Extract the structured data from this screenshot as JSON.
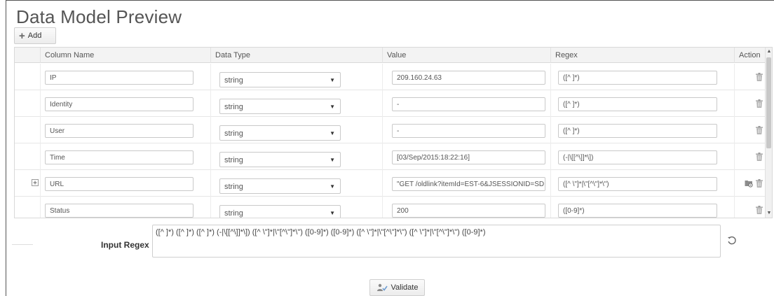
{
  "page": {
    "title": "Data Model Preview"
  },
  "toolbar": {
    "add_label": "Add",
    "add_icon": "plus-icon"
  },
  "table": {
    "columns": [
      "Column Name",
      "Data Type",
      "Value",
      "Regex",
      "Action"
    ],
    "rows": [
      {
        "column_name": "IP",
        "data_type": "string",
        "value": "209.160.24.63",
        "regex": "([^ ]*)",
        "expandable": false,
        "has_secondary_action": false
      },
      {
        "column_name": "Identity",
        "data_type": "string",
        "value": "-",
        "regex": "([^ ]*)",
        "expandable": false,
        "has_secondary_action": false
      },
      {
        "column_name": "User",
        "data_type": "string",
        "value": "-",
        "regex": "([^ ]*)",
        "expandable": false,
        "has_secondary_action": false
      },
      {
        "column_name": "Time",
        "data_type": "string",
        "value": "[03/Sep/2015:18:22:16]",
        "regex": "(-|\\[[^\\]]*\\])",
        "expandable": false,
        "has_secondary_action": false
      },
      {
        "column_name": "URL",
        "data_type": "string",
        "value": "\"GET /oldlink?itemId=EST-6&JSESSIONID=SD",
        "regex": "([^ \\\"]*|\\\"[^\\\"]*\\\")",
        "expandable": true,
        "has_secondary_action": true
      },
      {
        "column_name": "Status",
        "data_type": "string",
        "value": "200",
        "regex": "([0-9]*)",
        "expandable": false,
        "has_secondary_action": false
      }
    ]
  },
  "input_regex": {
    "label": "Input Regex",
    "value": "([^ ]*) ([^ ]*) ([^ ]*) (-|\\[[^\\]]*\\]) ([^ \\\"]*|\\\"[^\\\"]*\\\") ([0-9]*) ([0-9]*) ([^ \\\"]*|\\\"[^\\\"]*\\\") ([^ \\\"]*|\\\"[^\\\"]*\\\") ([0-9]*)"
  },
  "actions": {
    "validate_label": "Validate"
  },
  "icons": {
    "trash": "trash-icon",
    "reset": "reset-icon",
    "expand": "expand-icon",
    "validate": "validate-icon",
    "secondary": "folder-settings-icon"
  },
  "colors": {
    "icon_gray": "#9a9a9a",
    "border": "#cfcfcf"
  }
}
